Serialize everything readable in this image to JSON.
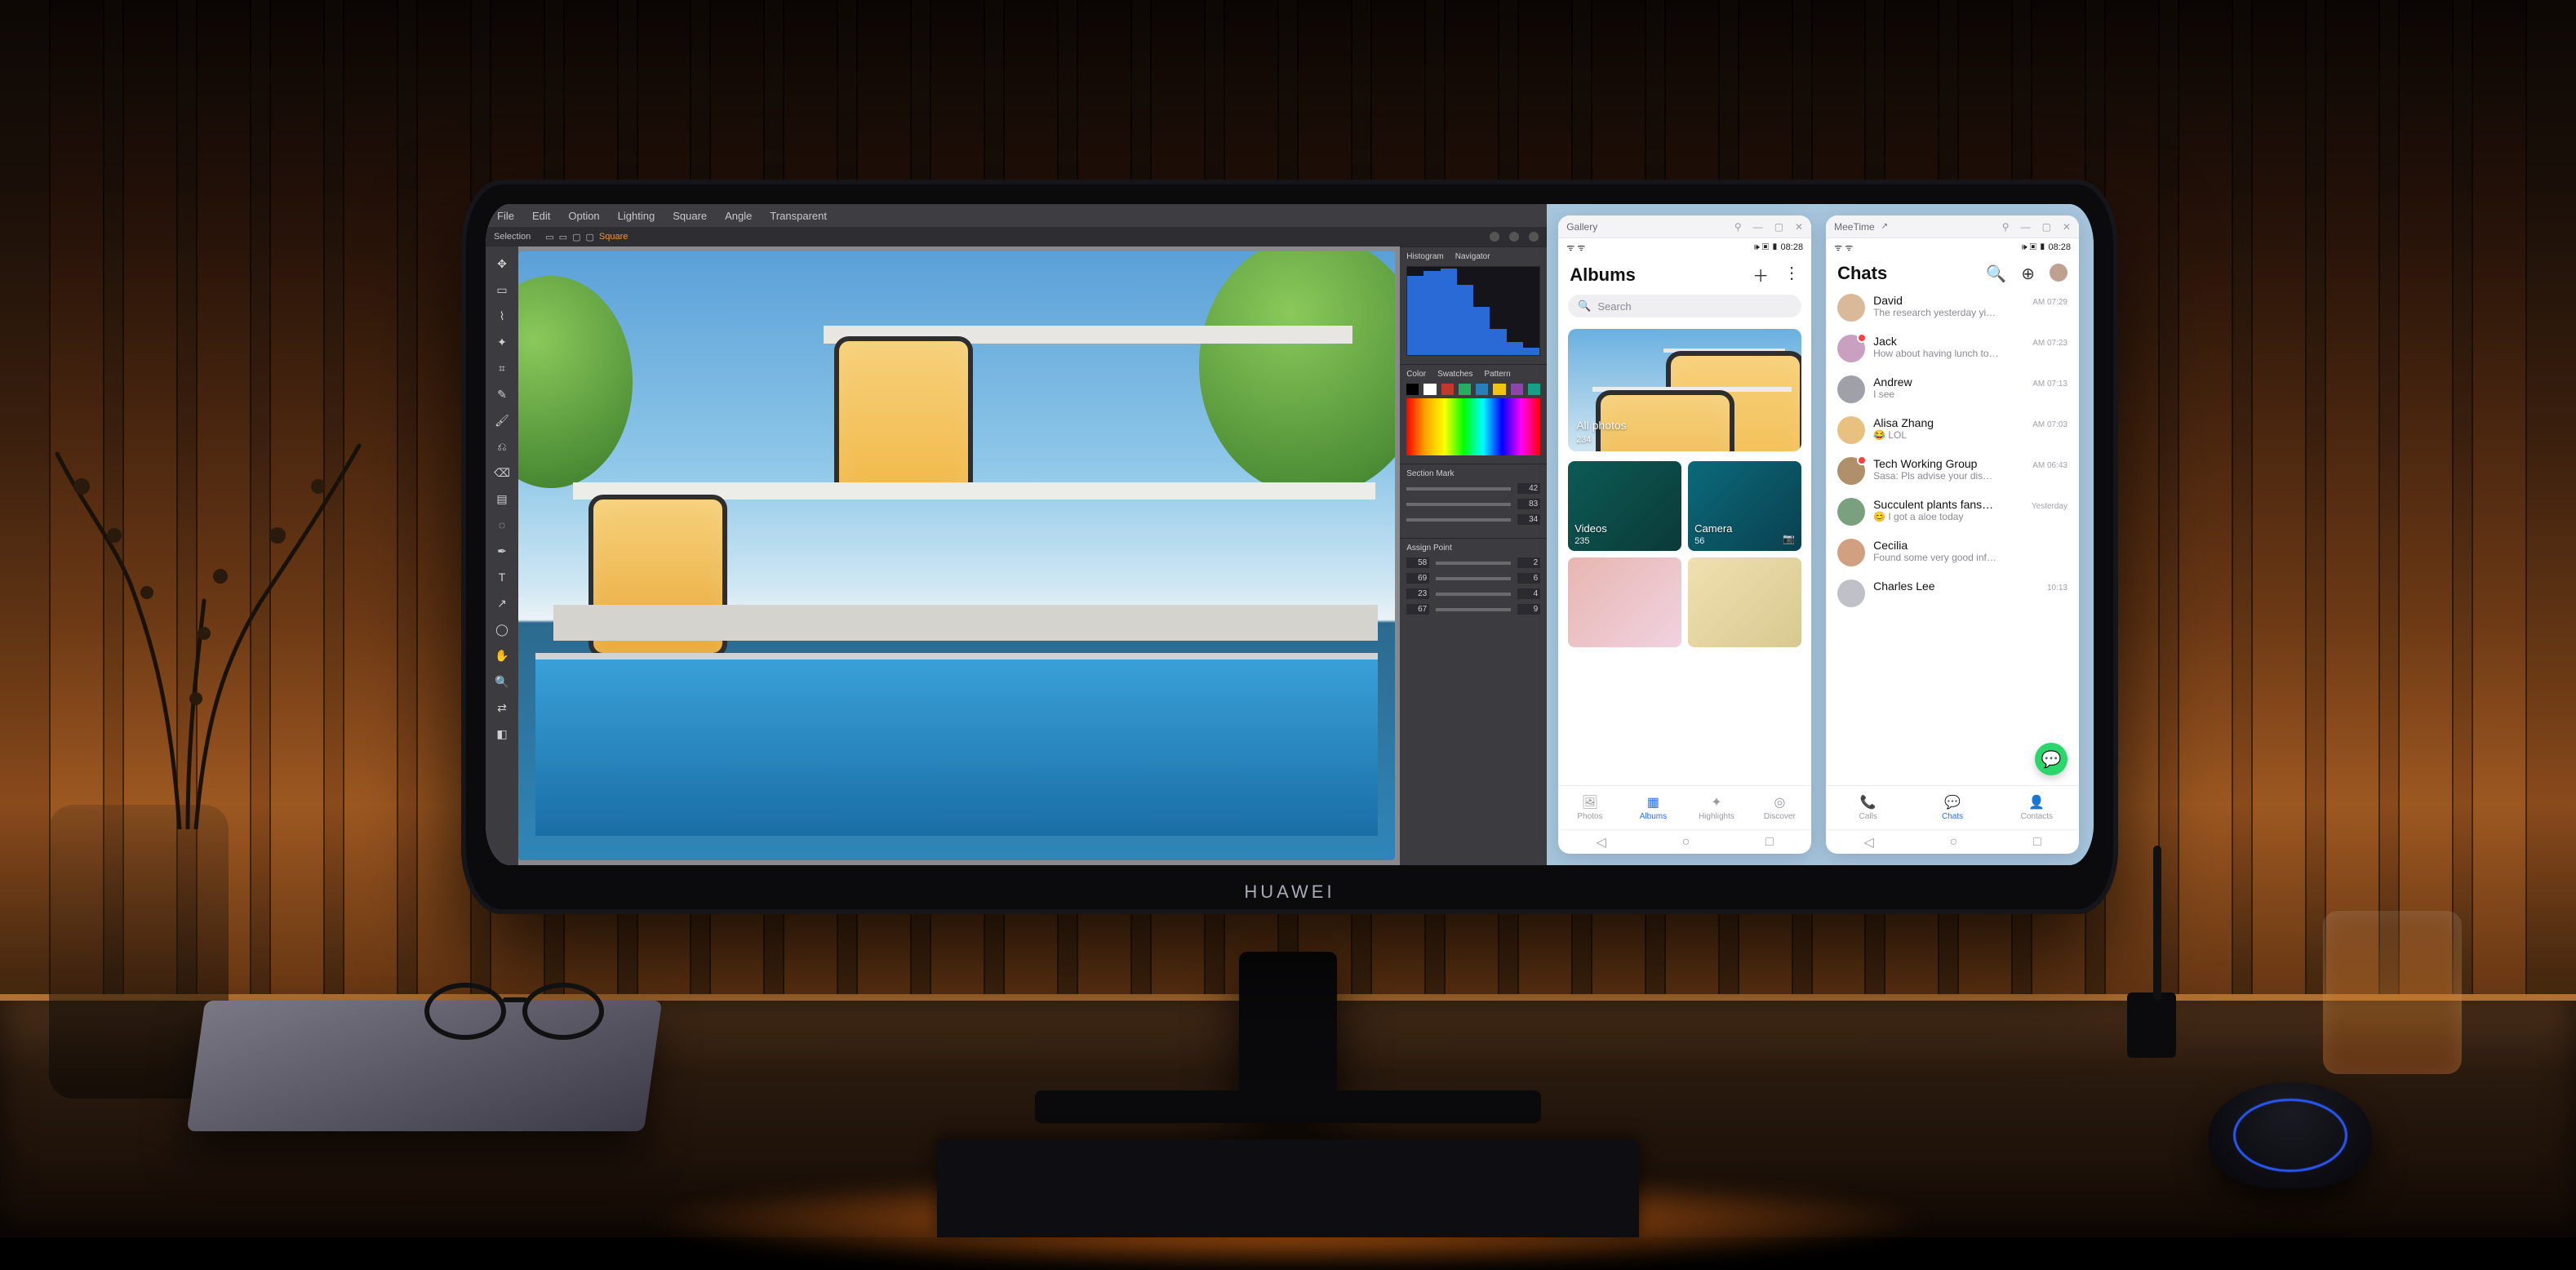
{
  "monitor": {
    "brand": "HUAWEI"
  },
  "editor": {
    "menu": [
      "File",
      "Edit",
      "Option",
      "Lighting",
      "Square",
      "Angle",
      "Transparent"
    ],
    "toolbar": {
      "selection_label": "Selection",
      "square_label": "Square"
    },
    "tool_icons": [
      "move",
      "marquee",
      "lasso",
      "wand",
      "crop",
      "eyedrop",
      "brush",
      "stamp",
      "eraser",
      "gradient",
      "blur",
      "pen",
      "text",
      "path",
      "shape",
      "hand",
      "zoom",
      "swap",
      "fgbg"
    ],
    "panels": {
      "histogram": {
        "tabs": [
          "Histogram",
          "Navigator"
        ]
      },
      "swatches": {
        "tabs": [
          "Color",
          "Swatches",
          "Pattern"
        ],
        "colors": [
          "#000000",
          "#ffffff",
          "#c0392b",
          "#27ae60",
          "#2980b9",
          "#f1c40f",
          "#8e44ad",
          "#16a085"
        ]
      },
      "section": {
        "title": "Section Mark",
        "sliders": [
          {
            "value": "42"
          },
          {
            "value": "83"
          },
          {
            "value": "34"
          }
        ]
      },
      "assign": {
        "title": "Assign Point",
        "rows": [
          {
            "l": "58",
            "r": "2"
          },
          {
            "l": "69",
            "r": "6"
          },
          {
            "l": "23",
            "r": "4"
          },
          {
            "l": "67",
            "r": "9"
          }
        ]
      }
    }
  },
  "gallery": {
    "window_title": "Gallery",
    "status_left": "ᯤ ᯤ",
    "status_right": "🕪 ▣ ▮ 08:28",
    "header": "Albums",
    "search_placeholder": "Search",
    "hero": {
      "label": "All photos",
      "count": "234"
    },
    "tiles": [
      {
        "label": "Videos",
        "count": "235",
        "bg": "linear-gradient(135deg,#0d5a55,#0a3a38)"
      },
      {
        "label": "Camera",
        "count": "56",
        "bg": "linear-gradient(135deg,#0a6a7a,#0a4050)"
      },
      {
        "label": "",
        "count": "",
        "bg": "linear-gradient(135deg,#e8b6b0,#f0d2e0)"
      },
      {
        "label": "",
        "count": "",
        "bg": "linear-gradient(135deg,#f0e0b0,#d8c890)"
      }
    ],
    "tabs": [
      {
        "icon": "image-icon",
        "label": "Photos"
      },
      {
        "icon": "albums-icon",
        "label": "Albums"
      },
      {
        "icon": "highlights-icon",
        "label": "Highlights"
      },
      {
        "icon": "discover-icon",
        "label": "Discover"
      }
    ],
    "active_tab_index": 1
  },
  "meetime": {
    "window_title": "MeeTime",
    "status_left": "ᯤ ᯤ",
    "status_right": "🕪 ▣ ▮ 08:28",
    "header": "Chats",
    "chats": [
      {
        "name": "David",
        "msg": "The research yesterday yi…",
        "time": "AM 07:29",
        "unread": false,
        "avatar": "#d9b99a"
      },
      {
        "name": "Jack",
        "msg": "How about having lunch to…",
        "time": "AM 07:23",
        "unread": true,
        "avatar": "#c9a0c0"
      },
      {
        "name": "Andrew",
        "msg": "I see",
        "time": "AM 07:13",
        "unread": false,
        "avatar": "#a0a0a8"
      },
      {
        "name": "Alisa Zhang",
        "msg": "😂 LOL",
        "time": "AM 07:03",
        "unread": false,
        "avatar": "#e8c080"
      },
      {
        "name": "Tech Working Group",
        "msg": "Sasa: Pls advise your dis…",
        "time": "AM 06:43",
        "unread": true,
        "avatar": "#b0906a"
      },
      {
        "name": "Succulent plants fans…",
        "msg": "😊 I got a aloe today",
        "time": "Yesterday",
        "unread": false,
        "avatar": "#7aa080"
      },
      {
        "name": "Cecilia",
        "msg": "Found some very good inf…",
        "time": "",
        "unread": false,
        "avatar": "#d0a080"
      },
      {
        "name": "Charles Lee",
        "msg": "",
        "time": "10:13",
        "unread": false,
        "avatar": "#c0c0c8"
      }
    ],
    "tabs": [
      {
        "icon": "calls-icon",
        "label": "Calls"
      },
      {
        "icon": "chats-icon",
        "label": "Chats"
      },
      {
        "icon": "contacts-icon",
        "label": "Contacts"
      }
    ],
    "active_tab_index": 1
  }
}
